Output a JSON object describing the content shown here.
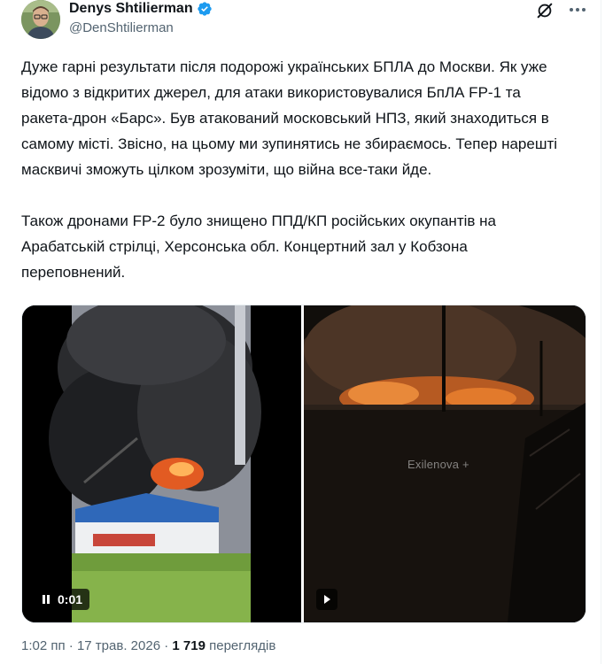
{
  "author": {
    "name": "Denys Shtilierman",
    "handle": "@DenShtilierman",
    "verified_color": "#1d9bf0"
  },
  "post": {
    "paragraphs": [
      "Дуже гарні результати після подорожі українських БПЛА до Москви. Як уже відомо з відкритих джерел, для атаки використовувалися БпЛА FP-1 та ракета-дрон «Барс». Був атакований московський НПЗ, який знаходиться в самому місті. Звісно, на цьому ми зупинятись не збираємось. Тепер нарешті масквичі зможуть цілком зрозуміти, що війна все-таки йде.",
      "Також дронами FP-2 було знищено ППД/КП російських окупантів на Арабатській стрілці, Херсонська обл. Концертний зал у Кобзона переповнений."
    ]
  },
  "media": {
    "video1": {
      "time": "0:01",
      "control_icon": "pause-icon"
    },
    "video2": {
      "control_icon": "play-icon",
      "watermark": "Exilenova +"
    }
  },
  "meta": {
    "time": "1:02 пп",
    "separator": "·",
    "date": "17 трав. 2026",
    "views_count": "1 719",
    "views_label": "переглядів"
  },
  "icons": [
    "verified-badge-icon",
    "grok-icon",
    "more-icon",
    "pause-icon",
    "play-icon"
  ]
}
